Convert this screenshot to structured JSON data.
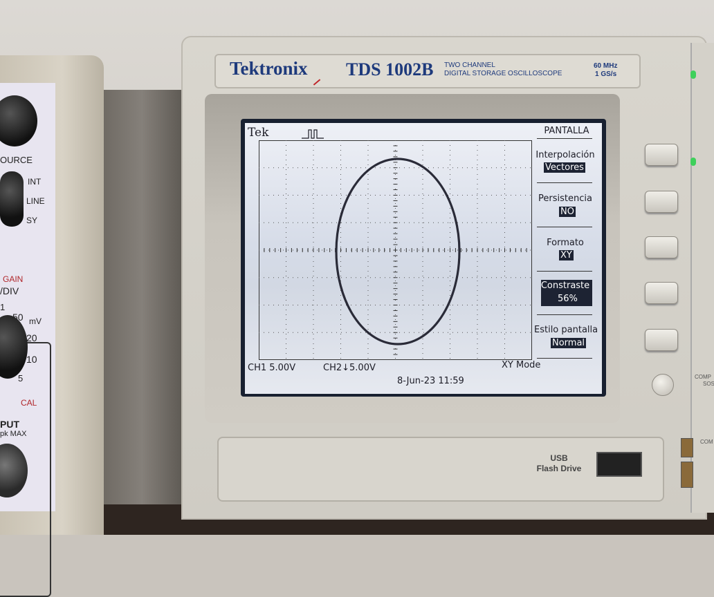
{
  "left_instrument": {
    "source_label": "OURCE",
    "int_label": "INT",
    "line_label": "LINE",
    "ext_label": "SY",
    "gain_label": "GAIN",
    "div_label": "/DIV",
    "mv_label": "mV",
    "scale": [
      "1",
      "50",
      "20",
      "10",
      "5"
    ],
    "cal_label": "CAL",
    "input_label": "PUT",
    "max_label": "pk MAX"
  },
  "scope": {
    "brand": "Tektronix",
    "model": "TDS 1002B",
    "desc_line1": "TWO CHANNEL",
    "desc_line2": "DIGITAL STORAGE OSCILLOSCOPE",
    "bandwidth": "60 MHz",
    "sample_rate": "1 GS/s",
    "usb_line1": "USB",
    "usb_line2": "Flash Drive",
    "right_text1": "COMP",
    "right_text2": "SOS",
    "right_text3": "COM"
  },
  "display": {
    "brand": "Tek",
    "ch1": "CH1  5.00V",
    "ch2": "CH2↓5.00V",
    "mode": "XY Mode",
    "datetime": "8-Jun-23 11:59",
    "menu": {
      "title": "PANTALLA",
      "items": [
        {
          "label": "Interpolación",
          "value": "Vectores"
        },
        {
          "label": "Persistencia",
          "value": "NO"
        },
        {
          "label": "Formato",
          "value": "XY"
        },
        {
          "label": "Constraste",
          "value": "56%"
        },
        {
          "label": "Estilo pantalla",
          "value": "Normal"
        }
      ]
    }
  }
}
